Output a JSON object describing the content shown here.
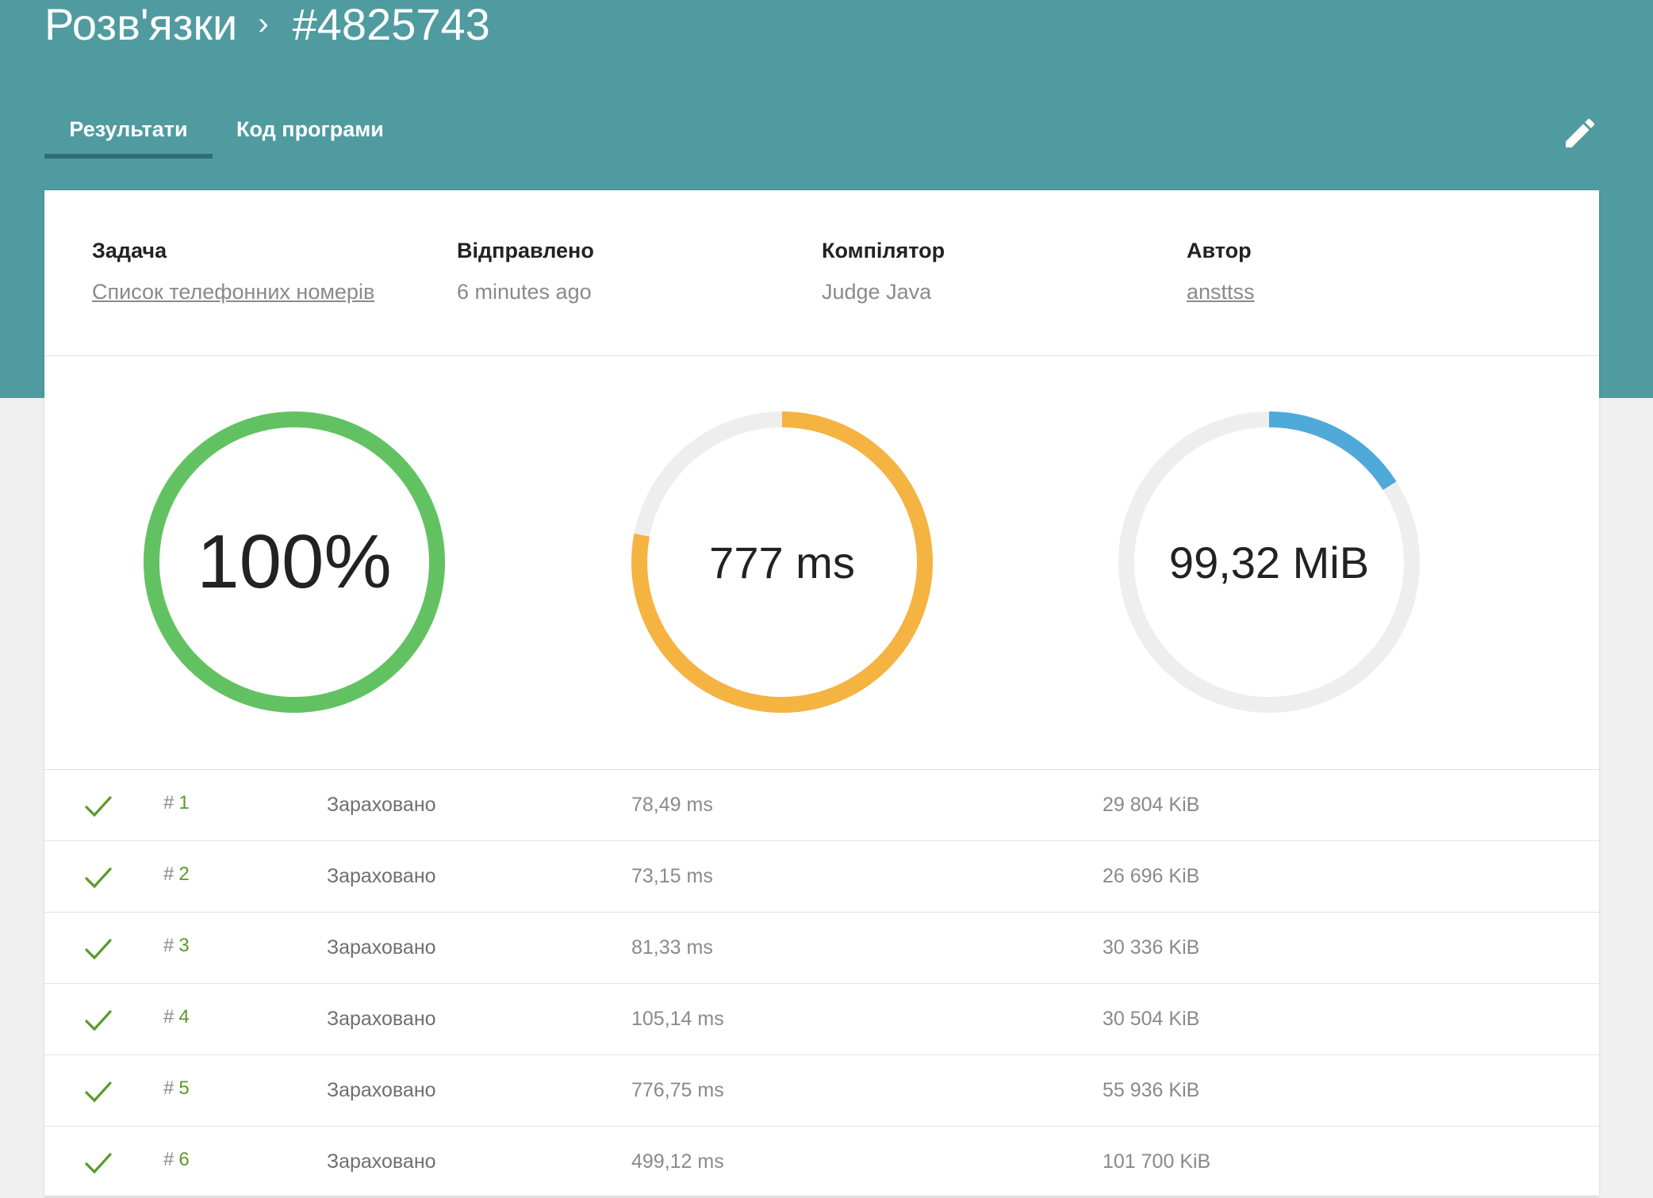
{
  "header": {
    "section_title": "Розв'язки",
    "separator": "›",
    "submission_id": "#4825743",
    "tabs": [
      {
        "label": "Результати",
        "active": true
      },
      {
        "label": "Код програми",
        "active": false
      }
    ],
    "edit_icon": "pencil-icon",
    "background_color": "#4f9ba0"
  },
  "meta": {
    "task": {
      "label": "Задача",
      "value": "Список телефонних номерів"
    },
    "sent": {
      "label": "Відправлено",
      "value": "6 minutes ago"
    },
    "compiler": {
      "label": "Компілятор",
      "value": "Judge Java"
    },
    "author": {
      "label": "Автор",
      "value": "ansttss"
    }
  },
  "gauges": [
    {
      "name": "score",
      "text": "100%",
      "fill": 1.0,
      "color": "#62c262"
    },
    {
      "name": "time",
      "text": "777 ms",
      "fill": 0.78,
      "color": "#f5b342"
    },
    {
      "name": "memory",
      "text": "99,32 MiB",
      "fill": 0.16,
      "color": "#4fa9d9"
    }
  ],
  "results": [
    {
      "num": "1",
      "status": "Зараховано",
      "time": "78,49 ms",
      "memory": "29 804 KiB"
    },
    {
      "num": "2",
      "status": "Зараховано",
      "time": "73,15 ms",
      "memory": "26 696 KiB"
    },
    {
      "num": "3",
      "status": "Зараховано",
      "time": "81,33 ms",
      "memory": "30 336 KiB"
    },
    {
      "num": "4",
      "status": "Зараховано",
      "time": "105,14 ms",
      "memory": "30 504 KiB"
    },
    {
      "num": "5",
      "status": "Зараховано",
      "time": "776,75 ms",
      "memory": "55 936 KiB"
    },
    {
      "num": "6",
      "status": "Зараховано",
      "time": "499,12 ms",
      "memory": "101 700 KiB"
    }
  ],
  "result_hash": "#",
  "check_icon": "check-icon",
  "colors": {
    "check": "#5a9a2c",
    "track": "#eeeeee"
  }
}
